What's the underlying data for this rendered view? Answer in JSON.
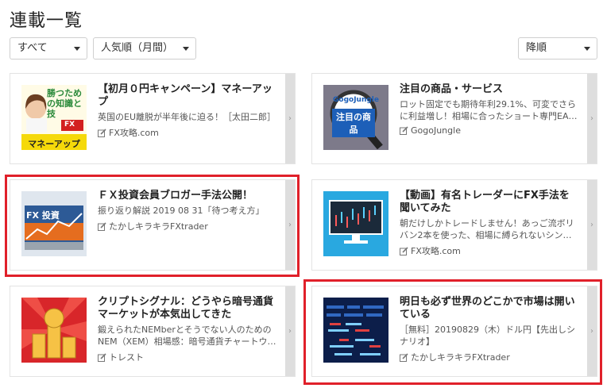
{
  "page": {
    "title": "連載一覧"
  },
  "filters": {
    "category": "すべて",
    "sort": "人気順（月間）",
    "order": "降順"
  },
  "cards": [
    {
      "title": "【初月０円キャンペーン】マネーアップ",
      "desc": "英国のEU離脱が半年後に迫る！［太田二郎］",
      "author": "FX攻略.com",
      "thumb_text": "勝つための知識と技",
      "thumb_text2": "マネーアップ",
      "thumb_text3": "FX"
    },
    {
      "title": "注目の商品・サービス",
      "desc": "ロット固定でも期待年利29.1%、可変でさらに利益増し！相場に合ったショート専門EA…",
      "author": "GogoJungle",
      "thumb_text": "GogoJungle",
      "thumb_text2": "注目の商品"
    },
    {
      "title": "ＦＸ投資会員ブロガー手法公開！",
      "desc": "振り返り解説 2019 08 31「待つ考え方」",
      "author": "たかしキラキラFXtrader",
      "thumb_text": "FX 投資"
    },
    {
      "title": "【動画】有名トレーダーにFX手法を聞いてみた",
      "desc": "朝だけしかトレードしません！あっご流ボリバン2本を使った、相場に縛られないシン…",
      "author": "FX攻略.com"
    },
    {
      "title": "クリプトシグナル：どうやら暗号通貨マーケットが本気出してきた",
      "desc": "鍛えられたNEMberとそうでない人のためのNEM（XEM）相場感：暗号通貨チャートウ…",
      "author": "トレスト"
    },
    {
      "title": "明日も必ず世界のどこかで市場は開いている",
      "desc": "［無料］20190829（木）ドル円【先出しシナリオ】",
      "author": "たかしキラキラFXtrader"
    }
  ],
  "colors": {
    "highlight": "#e0202a",
    "accent_yellow": "#f5d90a"
  }
}
